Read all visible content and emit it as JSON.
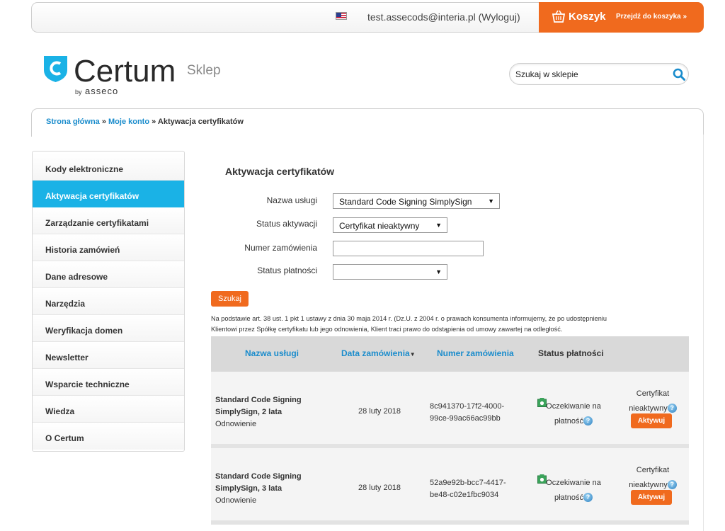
{
  "topbar": {
    "user_text": "test.assecods@interia.pl (Wyloguj)",
    "cart_label": "Koszyk",
    "cart_link": "Przejdź do koszyka »"
  },
  "logo": {
    "name": "Certum",
    "by": "by",
    "brand": "asseco",
    "shop": "Sklep"
  },
  "search": {
    "placeholder": "Szukaj w sklepie"
  },
  "breadcrumb": {
    "home": "Strona główna",
    "sep": " » ",
    "account": "Moje konto",
    "current": "Aktywacja certyfikatów"
  },
  "sidebar": {
    "items": [
      {
        "label": "Kody elektroniczne"
      },
      {
        "label": "Aktywacja certyfikatów"
      },
      {
        "label": "Zarządzanie certyfikatami"
      },
      {
        "label": "Historia zamówień"
      },
      {
        "label": "Dane adresowe"
      },
      {
        "label": "Narzędzia"
      },
      {
        "label": "Weryfikacja domen"
      },
      {
        "label": "Newsletter"
      },
      {
        "label": "Wsparcie techniczne"
      },
      {
        "label": "Wiedza"
      },
      {
        "label": "O Certum"
      }
    ]
  },
  "main": {
    "title": "Aktywacja certyfikatów",
    "form": {
      "service_label": "Nazwa usługi",
      "service_value": "Standard Code Signing SimplySign",
      "status_label": "Status aktywacji",
      "status_value": "Certyfikat nieaktywny",
      "order_label": "Numer zamówienia",
      "order_value": "",
      "payment_label": "Status płatności",
      "payment_value": ""
    },
    "search_button": "Szukaj",
    "legal_line1": "Na podstawie art. 38 ust. 1 pkt 1 ustawy z dnia 30 maja 2014 r. (Dz.U. z 2004 r. o prawach konsumenta informujemy, że po udostępnieniu",
    "legal_line2": "Klientowi przez Spółkę certyfikatu lub jego odnowienia, Klient traci prawo do odstąpienia od umowy zawartej na odległość.",
    "table": {
      "headers": {
        "service": "Nazwa usługi",
        "date": "Data zamówienia",
        "number": "Numer zamówienia",
        "payment": "Status płatności"
      },
      "rows": [
        {
          "name_line1": "Standard Code Signing",
          "name_line2": "SimplySign, 2 lata",
          "type": "Odnowienie",
          "date": "28 luty 2018",
          "number_line1": "8c941370-17f2-4000-",
          "number_line2": "99ce-99ac66ac99bb",
          "pay_line1": "Oczekiwanie na",
          "pay_line2": "płatność",
          "act_line1": "Certyfikat",
          "act_line2": "nieaktywny",
          "button": "Aktywuj"
        },
        {
          "name_line1": "Standard Code Signing",
          "name_line2": "SimplySign, 3 lata",
          "type": "Odnowienie",
          "date": "28 luty 2018",
          "number_line1": "52a9e92b-bcc7-4417-",
          "number_line2": "be48-c02e1fbc9034",
          "pay_line1": "Oczekiwanie na",
          "pay_line2": "płatność",
          "act_line1": "Certyfikat",
          "act_line2": "nieaktywny",
          "button": "Aktywuj"
        }
      ]
    }
  },
  "colors": {
    "accent_orange": "#f06a1e",
    "accent_blue": "#1ab2e6",
    "link_blue": "#1a8ccc"
  }
}
